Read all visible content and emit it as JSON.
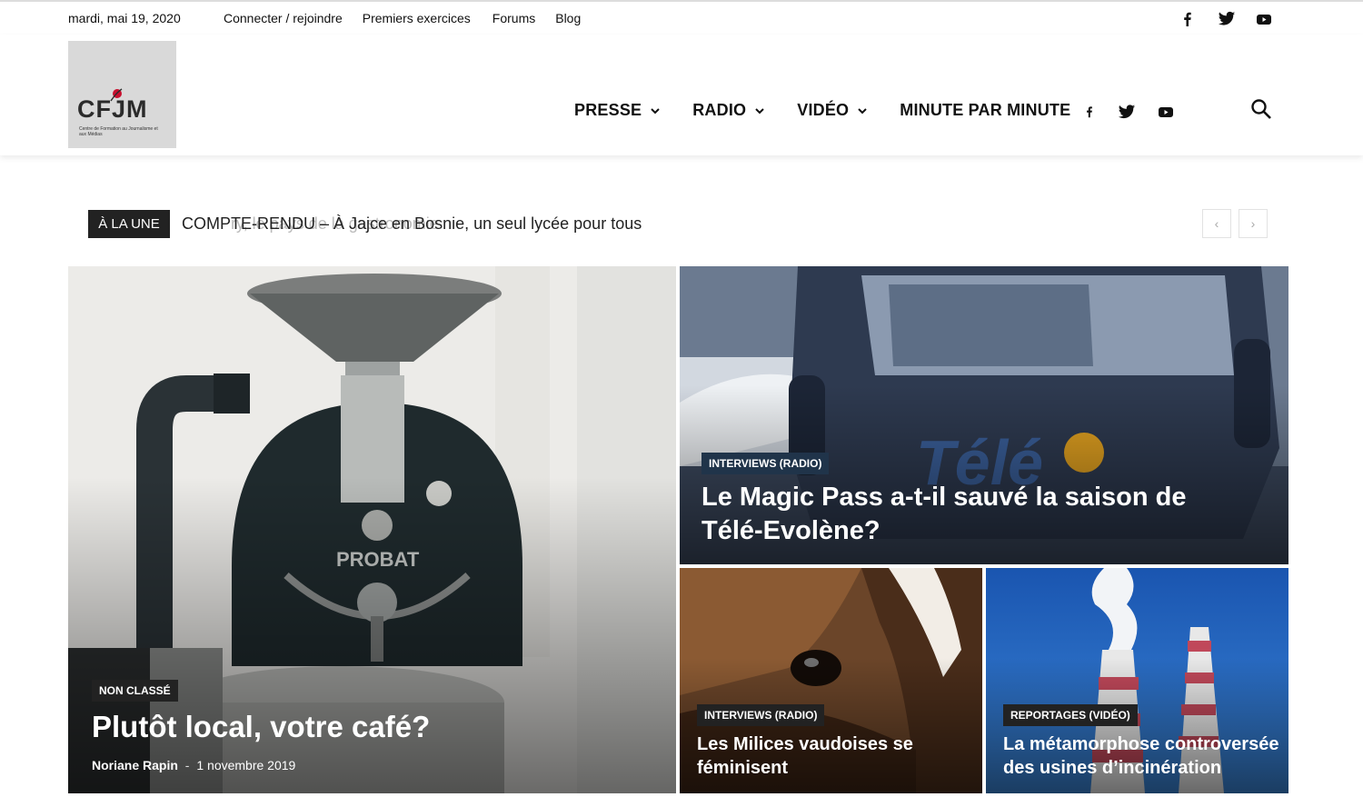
{
  "topbar": {
    "date": "mardi, mai 19, 2020",
    "links": [
      "Connecter / rejoindre",
      "Premiers exercices",
      "Forums",
      "Blog"
    ],
    "social_icons": [
      "facebook-icon",
      "twitter-icon",
      "youtube-icon"
    ]
  },
  "header": {
    "logo_text": "CFJM",
    "logo_subtitle": "Centre de Formation au Journalisme et aux Médias",
    "nav": [
      {
        "label": "PRESSE",
        "has_dropdown": true
      },
      {
        "label": "RADIO",
        "has_dropdown": true
      },
      {
        "label": "VIDÉO",
        "has_dropdown": true
      },
      {
        "label": "MINUTE PAR MINUTE",
        "has_dropdown": false
      }
    ],
    "social_icons": [
      "facebook-icon",
      "twitter-icon",
      "youtube-icon"
    ],
    "search_icon": "search-icon"
  },
  "ticker": {
    "label": "À LA UNE",
    "current": "COMPTE-RENDU – À Jajce en Bosnie, un seul lycée pour tous",
    "ghost": "ry, le pays de la gastronomie",
    "prev": "‹",
    "next": "›"
  },
  "articles": [
    {
      "category": "NON CLASSÉ",
      "title": "Plutôt local, votre café?",
      "author": "Noriane Rapin",
      "separator": "-",
      "date": "1 novembre 2019"
    },
    {
      "category": "INTERVIEWS (RADIO)",
      "title": "Le Magic Pass a-t-il sauvé la saison de Télé-Evolène?"
    },
    {
      "category": "INTERVIEWS (RADIO)",
      "title": "Les Milices vaudoises se féminisent"
    },
    {
      "category": "REPORTAGES (VIDÉO)",
      "title": "La métamorphose controversée des usines d’incinération"
    }
  ],
  "colors": {
    "accent_dark": "#222222",
    "category_blue": "#20344a",
    "logo_red": "#c8102e"
  }
}
